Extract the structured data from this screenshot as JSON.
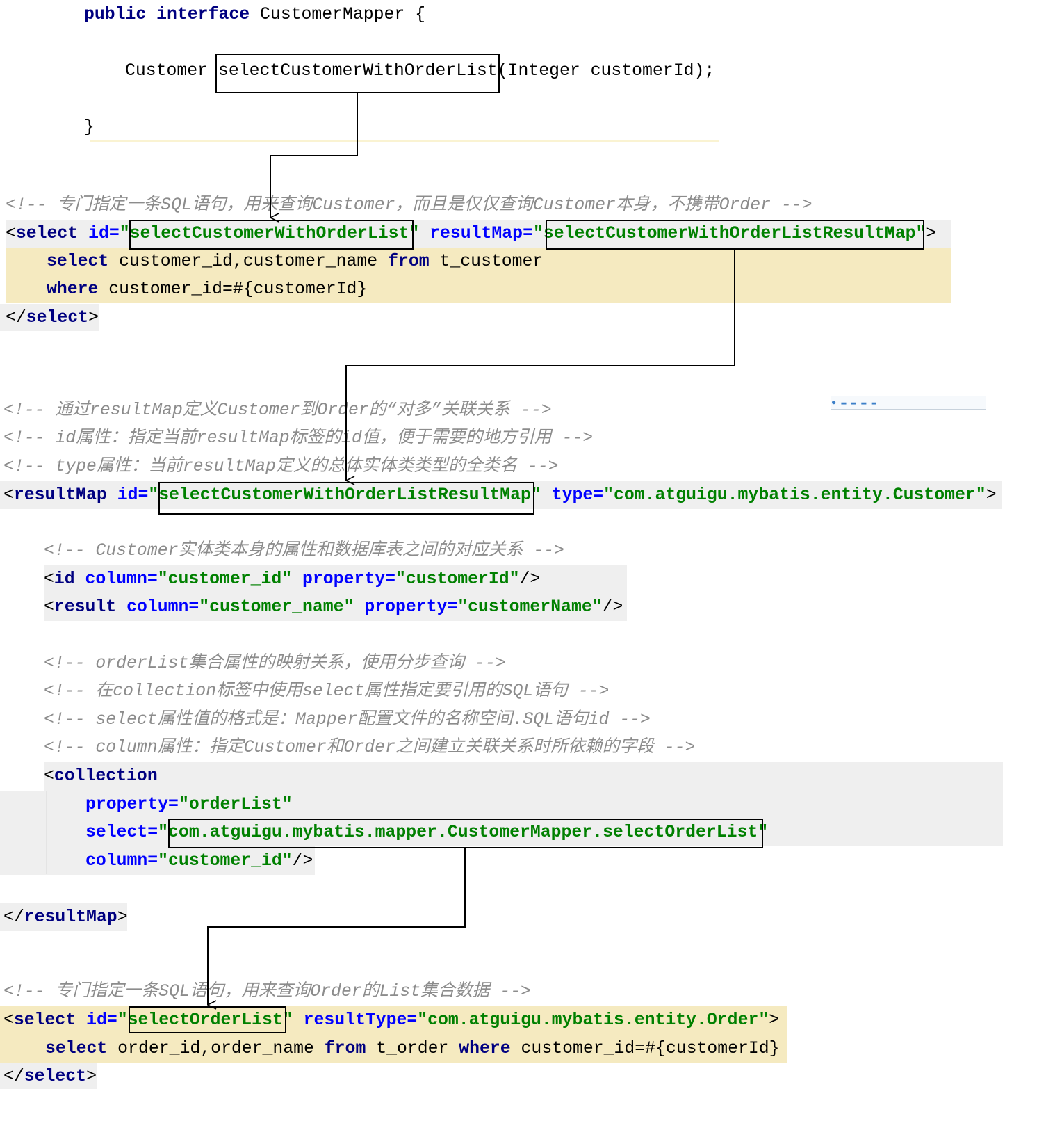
{
  "colors": {
    "keyword": "#000080",
    "attribute": "#0000ff",
    "value": "#008000",
    "comment": "#8c8c8c",
    "highlight_yellow": "#f5eac0",
    "highlight_gray": "#efefef"
  },
  "lines": [
    [
      [
        "k",
        "public interface"
      ],
      [
        "p",
        " CustomerMapper {"
      ]
    ],
    [
      [
        "p",
        "Customer "
      ],
      [
        "p",
        "selectCustomerWithOrderList"
      ],
      [
        "p",
        "(Integer customerId);"
      ]
    ],
    [
      [
        "p",
        "}"
      ]
    ],
    [
      [
        "c",
        "<!-- 专门指定一条SQL语句，用来查询Customer，而且是仅仅查询Customer本身，不携带Order -->"
      ]
    ],
    [
      [
        "p",
        "<"
      ],
      [
        "k",
        "select"
      ],
      [
        "a",
        " id="
      ],
      [
        "v",
        "\"selectCustomerWithOrderList\" "
      ],
      [
        "a",
        "resultMap="
      ],
      [
        "v",
        "\"selectCustomerWithOrderListResultMap\""
      ],
      [
        "p",
        ">"
      ]
    ],
    [
      [
        "k",
        "select"
      ],
      [
        "p",
        " customer_id,customer_name "
      ],
      [
        "k",
        "from"
      ],
      [
        "p",
        " t_customer"
      ]
    ],
    [
      [
        "k",
        "where"
      ],
      [
        "p",
        " customer_id=#{customerId}"
      ]
    ],
    [
      [
        "p",
        "</"
      ],
      [
        "k",
        "select"
      ],
      [
        "p",
        ">"
      ]
    ],
    [
      [
        "c",
        "<!-- 通过resultMap定义Customer到Order的“对多”关联关系 -->"
      ]
    ],
    [
      [
        "c",
        "<!-- id属性：指定当前resultMap标签的id值，便于需要的地方引用 -->"
      ]
    ],
    [
      [
        "c",
        "<!-- type属性：当前resultMap定义的总体实体类类型的全类名 -->"
      ]
    ],
    [
      [
        "p",
        "<"
      ],
      [
        "k",
        "resultMap"
      ],
      [
        "a",
        " id="
      ],
      [
        "v",
        "\"selectCustomerWithOrderListResultMap\" "
      ],
      [
        "a",
        "type="
      ],
      [
        "v",
        "\"com.atguigu.mybatis.entity.Customer\""
      ],
      [
        "p",
        ">"
      ]
    ],
    [
      [
        "c",
        "<!-- Customer实体类本身的属性和数据库表之间的对应关系 -->"
      ]
    ],
    [
      [
        "p",
        "<"
      ],
      [
        "k",
        "id"
      ],
      [
        "a",
        " column="
      ],
      [
        "v",
        "\"customer_id\" "
      ],
      [
        "a",
        "property="
      ],
      [
        "v",
        "\"customerId\""
      ],
      [
        "p",
        "/>"
      ]
    ],
    [
      [
        "p",
        "<"
      ],
      [
        "k",
        "result"
      ],
      [
        "a",
        " column="
      ],
      [
        "v",
        "\"customer_name\" "
      ],
      [
        "a",
        "property="
      ],
      [
        "v",
        "\"customerName\""
      ],
      [
        "p",
        "/>"
      ]
    ],
    [
      [
        "c",
        "<!-- orderList集合属性的映射关系，使用分步查询 -->"
      ]
    ],
    [
      [
        "c",
        "<!-- 在collection标签中使用select属性指定要引用的SQL语句 -->"
      ]
    ],
    [
      [
        "c",
        "<!-- select属性值的格式是：Mapper配置文件的名称空间.SQL语句id -->"
      ]
    ],
    [
      [
        "c",
        "<!-- column属性：指定Customer和Order之间建立关联关系时所依赖的字段 -->"
      ]
    ],
    [
      [
        "p",
        "<"
      ],
      [
        "k",
        "collection"
      ]
    ],
    [
      [
        "a",
        "property="
      ],
      [
        "v",
        "\"orderList\""
      ]
    ],
    [
      [
        "a",
        "select="
      ],
      [
        "v",
        "\"com.atguigu.mybatis.mapper.CustomerMapper.selectOrderList\""
      ]
    ],
    [
      [
        "a",
        "column="
      ],
      [
        "v",
        "\"customer_id\""
      ],
      [
        "p",
        "/>"
      ]
    ],
    [
      [
        "p",
        "</"
      ],
      [
        "k",
        "resultMap"
      ],
      [
        "p",
        ">"
      ]
    ],
    [
      [
        "c",
        "<!-- 专门指定一条SQL语句，用来查询Order的List集合数据 -->"
      ]
    ],
    [
      [
        "p",
        "<"
      ],
      [
        "k",
        "select"
      ],
      [
        "a",
        " id="
      ],
      [
        "v",
        "\"selectOrderList\" "
      ],
      [
        "a",
        "resultType="
      ],
      [
        "v",
        "\"com.atguigu.mybatis.entity.Order\""
      ],
      [
        "p",
        ">"
      ]
    ],
    [
      [
        "k",
        "select"
      ],
      [
        "p",
        " order_id,order_name "
      ],
      [
        "k",
        "from"
      ],
      [
        "p",
        " t_order "
      ],
      [
        "k",
        "where"
      ],
      [
        "p",
        " customer_id=#{customerId}"
      ]
    ],
    [
      [
        "p",
        "</"
      ],
      [
        "k",
        "select"
      ],
      [
        "p",
        ">"
      ]
    ]
  ]
}
